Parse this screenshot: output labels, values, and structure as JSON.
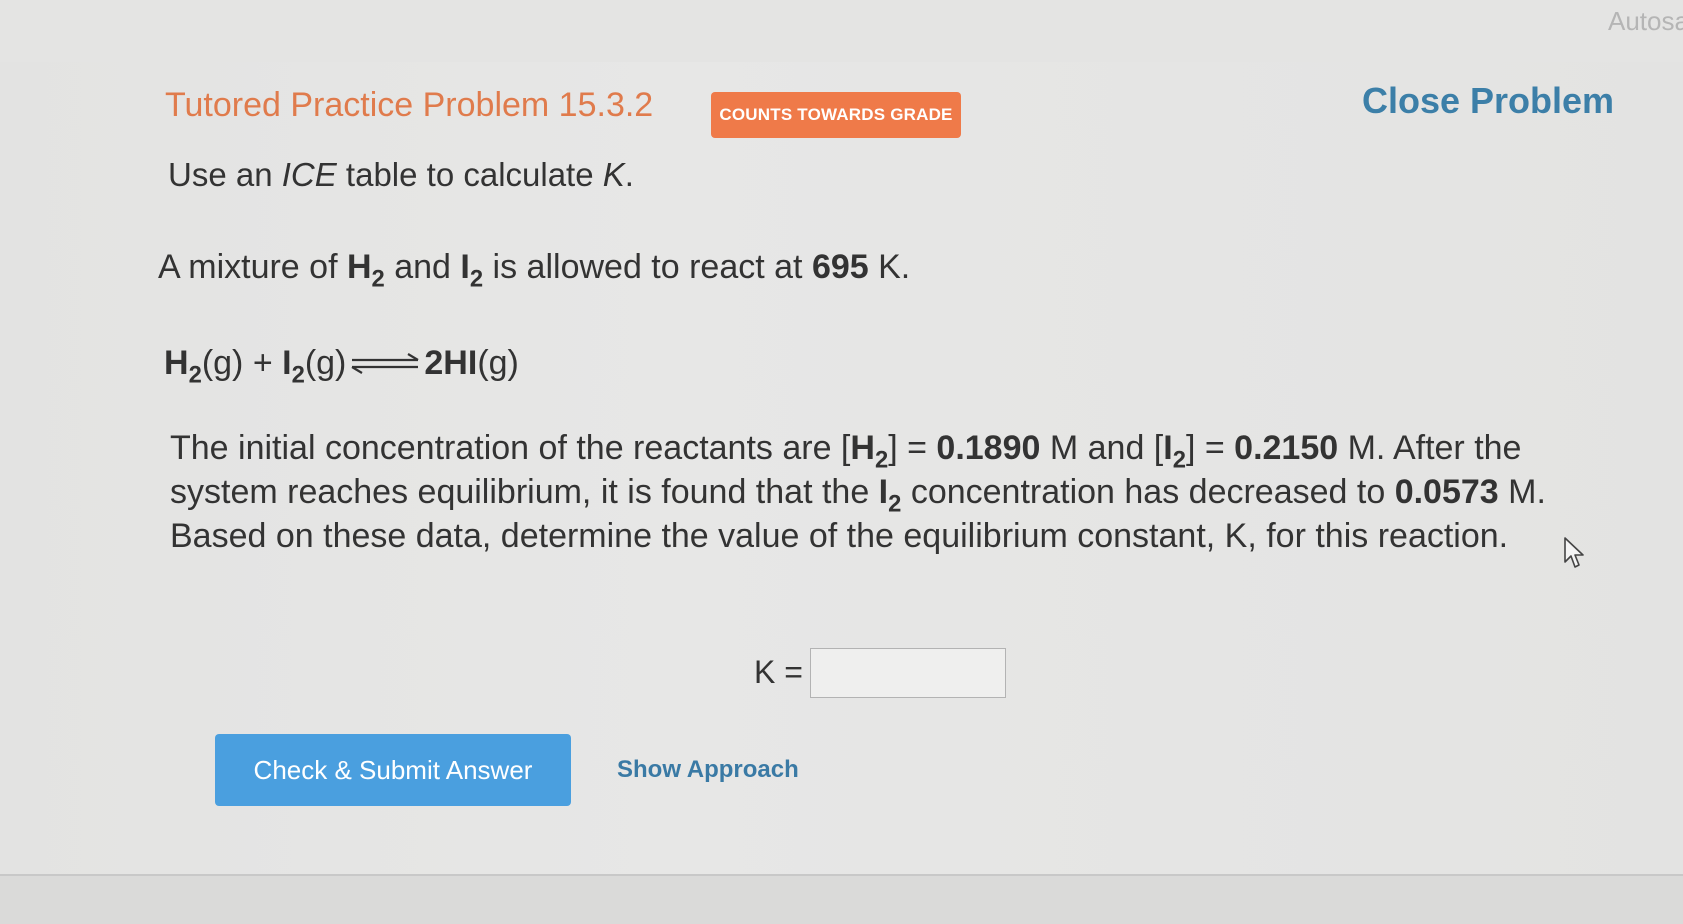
{
  "window": {
    "autosave_label": "Autosa"
  },
  "header": {
    "title": "Tutored Practice Problem 15.3.2",
    "badge": "COUNTS TOWARDS GRADE",
    "close_label": "Close Problem"
  },
  "problem": {
    "instruction_prefix": "Use an ",
    "instruction_italic_1": "ICE",
    "instruction_middle": " table to calculate ",
    "instruction_italic_2": "K",
    "instruction_suffix": ".",
    "mixture": {
      "t1": "A mixture of ",
      "h": "H",
      "sub_h": "2",
      "t2": " and ",
      "i": "I",
      "sub_i": "2",
      "t3": " is allowed to react at ",
      "temp": "695",
      "t4": " K."
    },
    "reaction": {
      "r1": "H",
      "r1_sub": "2",
      "r1_state": "(g) + ",
      "r2": "I",
      "r2_sub": "2",
      "r2_state": "(g)",
      "product": "2HI",
      "product_state": "(g)"
    },
    "paragraph": {
      "p1": "The initial concentration of the reactants are [",
      "h2": "H",
      "h2_sub": "2",
      "p2": "] = ",
      "h2_conc": "0.1890",
      "p3": " M and [",
      "i2": "I",
      "i2_sub": "2",
      "p4": "] = ",
      "i2_conc": "0.2150",
      "p5": " M. After the system reaches equilibrium, it is found that the ",
      "i2b": "I",
      "i2b_sub": "2",
      "p6": " concentration has decreased to ",
      "i2_eq": "0.0573",
      "p7": " M. Based on these data, determine the value of the equilibrium constant, K, for this reaction."
    }
  },
  "answer": {
    "k_label": "K =",
    "k_value": ""
  },
  "actions": {
    "submit_label": "Check & Submit Answer",
    "approach_label": "Show Approach"
  }
}
